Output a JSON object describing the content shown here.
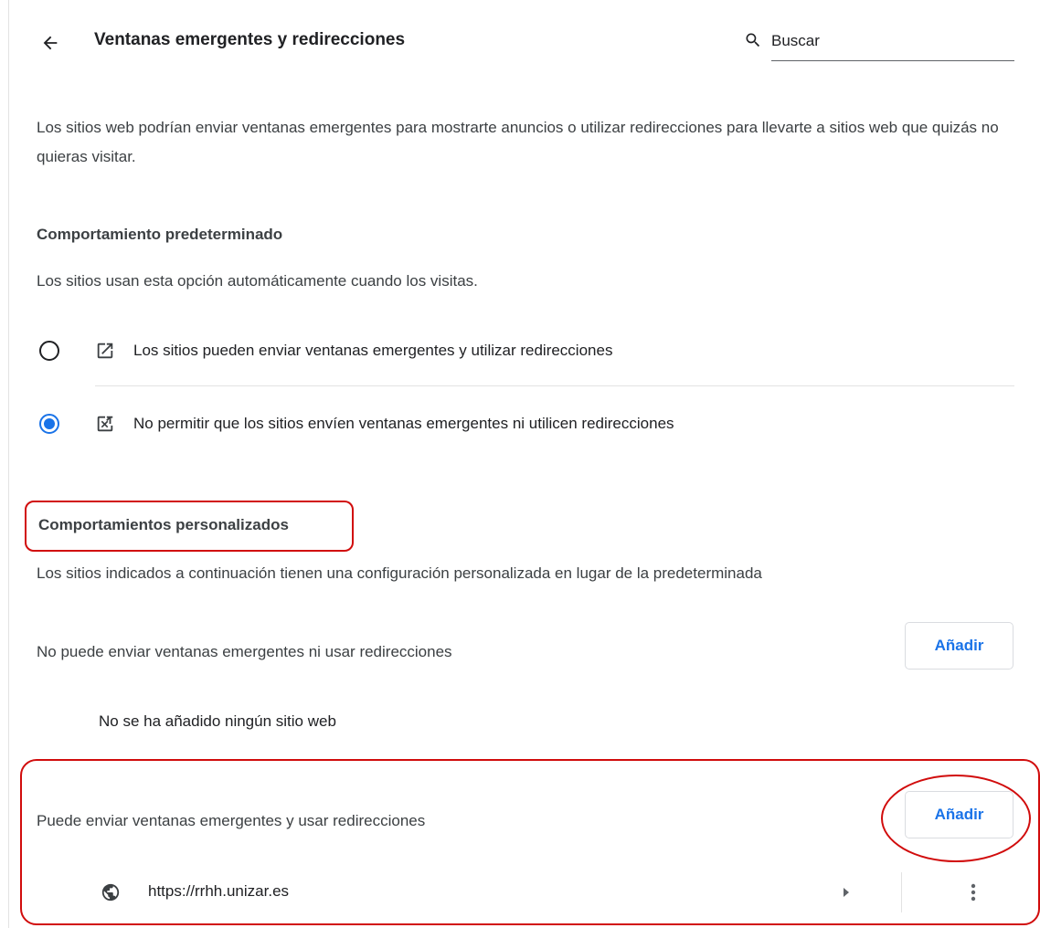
{
  "header": {
    "title": "Ventanas emergentes y redirecciones",
    "search_placeholder": "Buscar"
  },
  "description": "Los sitios web podrían enviar ventanas emergentes para mostrarte anuncios o utilizar redirecciones para llevarte a sitios web que quizás no quieras visitar.",
  "default_behavior": {
    "heading": "Comportamiento predeterminado",
    "subtitle": "Los sitios usan esta opción automáticamente cuando los visitas.",
    "options": [
      {
        "label": "Los sitios pueden enviar ventanas emergentes y utilizar redirecciones",
        "selected": false,
        "icon": "open-in-new-icon"
      },
      {
        "label": "No permitir que los sitios envíen ventanas emergentes ni utilicen redirecciones",
        "selected": true,
        "icon": "popup-blocked-icon"
      }
    ]
  },
  "custom_behaviors": {
    "heading": "Comportamientos personalizados",
    "subtitle": "Los sitios indicados a continuación tienen una configuración personalizada en lugar de la predeterminada",
    "blocked": {
      "label": "No puede enviar ventanas emergentes ni usar redirecciones",
      "add_label": "Añadir",
      "empty_message": "No se ha añadido ningún sitio web"
    },
    "allowed": {
      "label": "Puede enviar ventanas emergentes y usar redirecciones",
      "add_label": "Añadir",
      "sites": [
        {
          "url": "https://rrhh.unizar.es",
          "icon": "globe-icon"
        }
      ]
    }
  },
  "colors": {
    "accent": "#1a73e8",
    "annotation": "#d10c0c",
    "text": "#202124",
    "secondary_text": "#3c4043",
    "divider": "#e3e3e3"
  }
}
